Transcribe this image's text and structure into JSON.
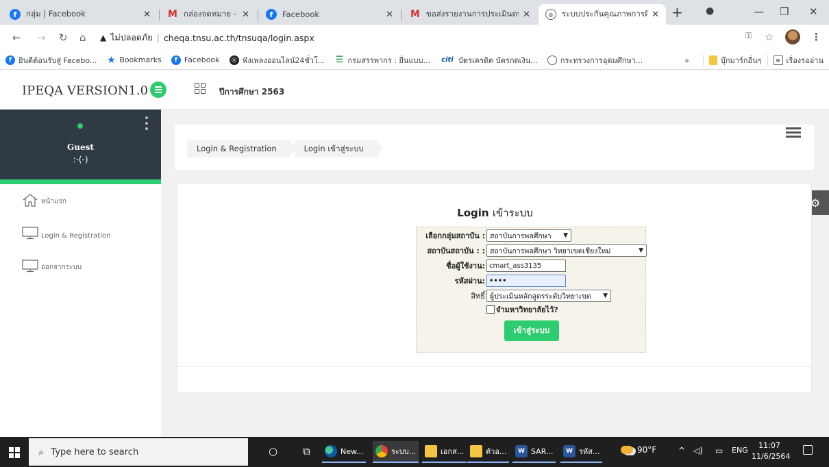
{
  "browser": {
    "tabs": [
      {
        "label": "กลุ่ม | Facebook",
        "icon": "facebook-icon",
        "active": false
      },
      {
        "label": "กล่องจดหมาย - jumsuksanee",
        "icon": "gmail-icon",
        "active": false
      },
      {
        "label": "Facebook",
        "icon": "facebook-icon",
        "active": false
      },
      {
        "label": "ขอส่งรายงานการประเมินตนเอง",
        "icon": "gmail-icon",
        "active": false
      },
      {
        "label": "ระบบประกันคุณภาพการศึกษา",
        "icon": "globe-icon",
        "active": true
      }
    ],
    "security_label": "ไม่ปลอดภัย",
    "url": "cheqa.tnsu.ac.th/tnsuqa/login.aspx",
    "bookmarks": [
      {
        "label": "ยินดีต้อนรับสู่ Facebo...",
        "icon": "facebook-icon"
      },
      {
        "label": "Bookmarks",
        "icon": "star-icon"
      },
      {
        "label": "Facebook",
        "icon": "facebook-icon"
      },
      {
        "label": "ฟังเพลงออนไลน์24ชั่วโ...",
        "icon": "soccer-ball-icon"
      },
      {
        "label": "กรมสรรพากร : ยื่นแบบ...",
        "icon": "rd-icon"
      },
      {
        "label": "บัตรเครดิต บัตรกดเงิน...",
        "icon": "citi-icon"
      },
      {
        "label": "กระทรวงการอุดมศึกษา...",
        "icon": "globe-icon"
      }
    ],
    "bookmarks_overflow": "»",
    "other_bookmarks": "บุ๊กมาร์กอื่นๆ",
    "reading_list": "เรื่องรออ่าน"
  },
  "app": {
    "brand": "IPEQA VERSION1.0",
    "year": "ปีการศึกษา 2563",
    "user": {
      "name": "Guest",
      "status": ":-(-)"
    },
    "nav": [
      {
        "label": "หน้าแรก",
        "icon": "home-icon"
      },
      {
        "label": "Login & Registration",
        "icon": "monitor-icon"
      },
      {
        "label": "ออกจากระบบ",
        "icon": "monitor-icon"
      }
    ],
    "breadcrumbs": [
      "Login & Registration",
      "Login เข้าสู่ระบบ"
    ]
  },
  "login": {
    "title": "Login",
    "title_sub": "เข้าระบบ",
    "group_label": "เลือกกลุ่มสถาบัน :",
    "group_value": "สถาบันการพลศึกษา",
    "institute_label": "สถาบันสถาบัน : :",
    "institute_value": "สถาบันการพลศึกษา วิทยาเขตเชียงใหม่",
    "username_label": "ชื่อผู้ใช้งาน:",
    "username_value": "cmart_ass3135",
    "password_label": "รหัสผ่าน:",
    "password_value": "••••",
    "role_label": "สิทธิ์",
    "role_value": "ผู้ประเมินหลักสูตรระดับวิทยาเขต",
    "remember_label": "จำมหาวิทยาลัยไว้?",
    "submit_label": "เข้าสู่ระบบ"
  },
  "taskbar": {
    "search_placeholder": "Type here to search",
    "apps": [
      {
        "label": "New...",
        "icon": "edge-icon"
      },
      {
        "label": "ระบบ...",
        "icon": "chrome-icon"
      },
      {
        "label": "เอกส...",
        "icon": "folder-icon"
      },
      {
        "label": "ตัวอ...",
        "icon": "folder-icon"
      },
      {
        "label": "SAR...",
        "icon": "word-icon"
      },
      {
        "label": "รหัส...",
        "icon": "word-icon"
      }
    ],
    "weather": "90°F",
    "language": "ENG",
    "time": "11:07",
    "date": "11/6/2564"
  }
}
